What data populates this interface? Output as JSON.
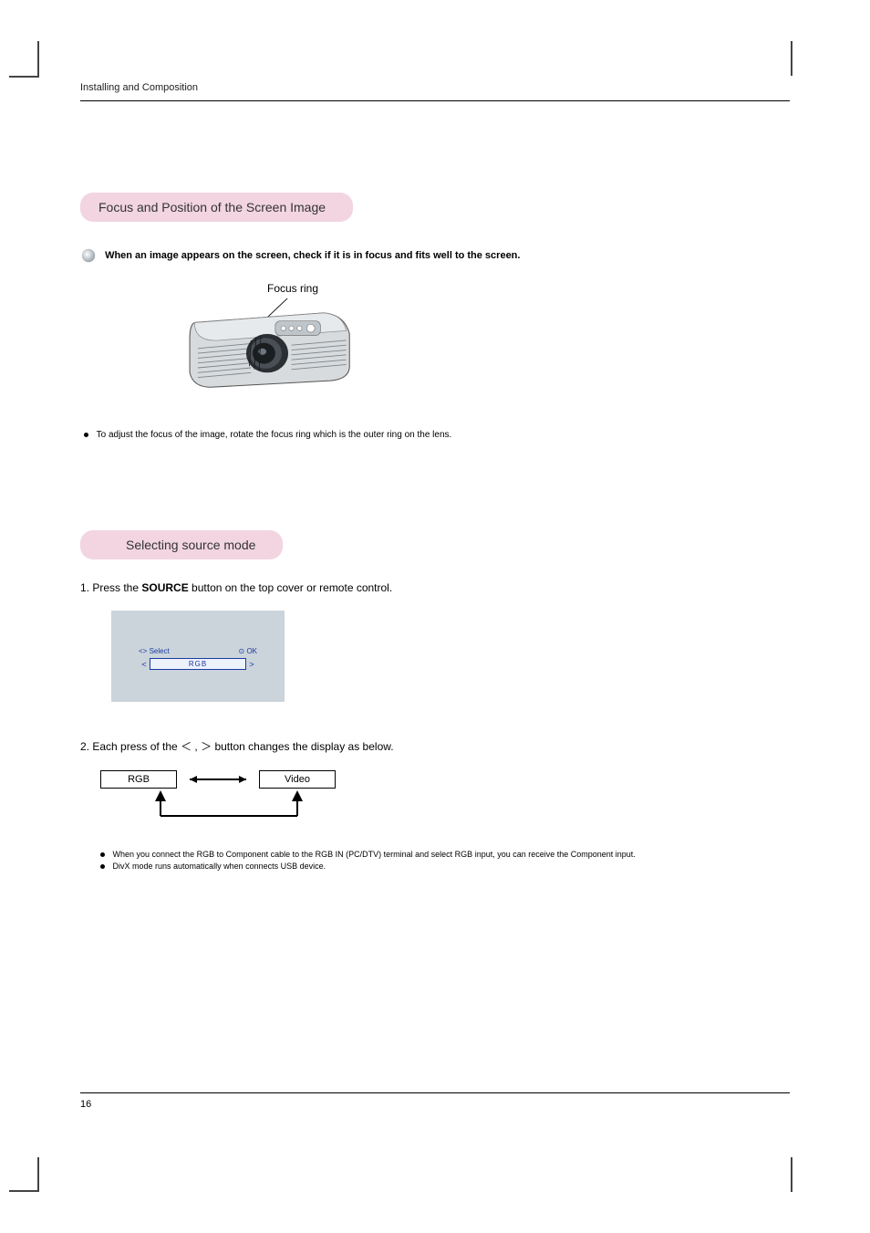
{
  "running_head": "Installing and Composition",
  "section1": {
    "title": "Focus and Position of the Screen Image",
    "intro": "When an image appears on the screen, check if it is in focus and fits well to the screen.",
    "focus_ring_label": "Focus ring",
    "bullet1": "To adjust the focus of the image, rotate the focus ring which is the outer ring on the lens."
  },
  "section2": {
    "title": "Selecting source mode",
    "step1_prefix": "1. Press the ",
    "step1_bold": "SOURCE",
    "step1_suffix": " button on the top cover or remote control.",
    "osd": {
      "select_label": "Select",
      "ok_label": "OK",
      "ok_icon": "⊙",
      "lt": "<",
      "gt": ">",
      "lrsymbol": "<>",
      "value": "RGB"
    },
    "step2_prefix": "2. Each press of the ",
    "step2_lt": "＜",
    "step2_comma": " , ",
    "step2_gt": "＞",
    "step2_suffix": " button changes the display as below.",
    "flow_left": "RGB",
    "flow_right": "Video",
    "note1": "When you connect the RGB to Component cable to the RGB IN (PC/DTV) terminal and select RGB input, you can receive the Component input.",
    "note2": "DivX mode runs automatically when connects USB device."
  },
  "page_number": "16"
}
